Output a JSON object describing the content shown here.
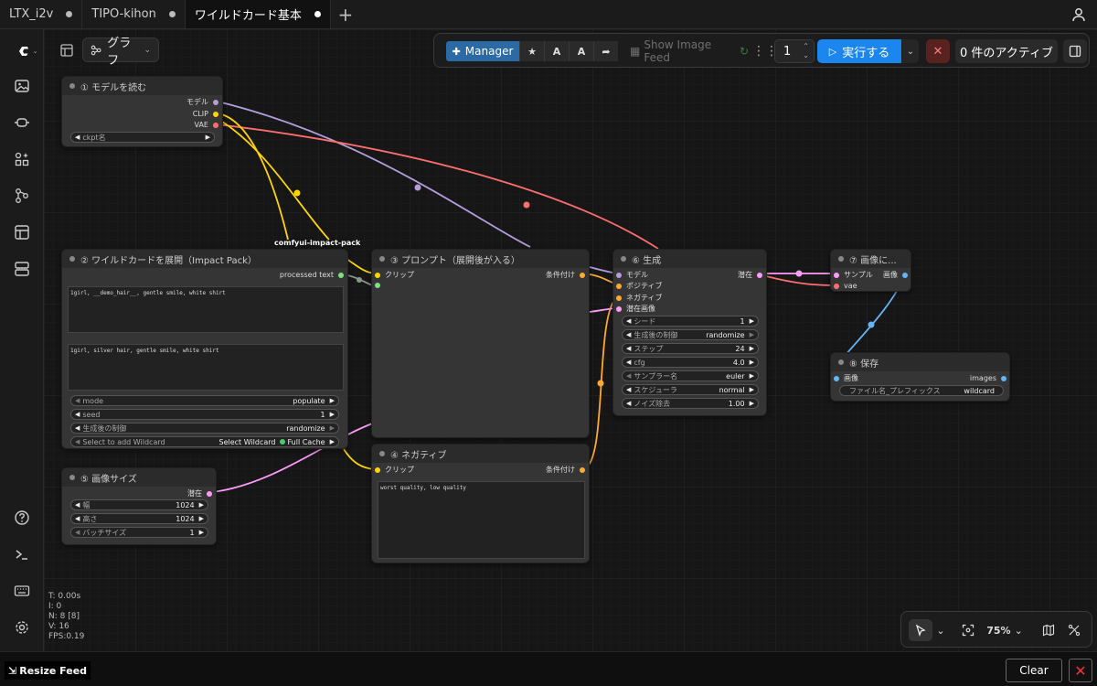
{
  "tabs": [
    {
      "label": "LTX_i2v"
    },
    {
      "label": "TIPO-kihon"
    },
    {
      "label": "ワイルドカード基本"
    }
  ],
  "toolbar": {
    "graph_label": "グラフ",
    "manager_label": "Manager",
    "show_feed_label": "Show Image Feed",
    "batch_count": "1",
    "run_label": "実行する",
    "queue_label": "0 件のアクティブ"
  },
  "group_label": "comfyui-impact-pack",
  "nodes": {
    "n1": {
      "title": "① モデルを読む",
      "outputs": [
        "モデル",
        "CLIP",
        "VAE"
      ],
      "widget_label": "ckpt名"
    },
    "n2": {
      "title": "② ワイルドカードを展開（Impact Pack）",
      "output": "processed text",
      "text1": "1girl, __demo_hair__, gentle smile, white shirt",
      "text2": "1girl, silver hair, gentle smile, white shirt",
      "widgets": [
        {
          "label": "mode",
          "value": "populate"
        },
        {
          "label": "seed",
          "value": "1"
        },
        {
          "label": "生成後の制御",
          "value": "randomize"
        }
      ],
      "wildcard": {
        "label": "Select to add Wildcard",
        "value": "Select Wildcard",
        "cache": "Full Cache"
      }
    },
    "n3": {
      "title": "③ プロンプト（展開後が入る）",
      "input": "クリップ",
      "output": "条件付け"
    },
    "n4": {
      "title": "④ ネガティブ",
      "input": "クリップ",
      "output": "条件付け",
      "text": "worst quality, low quality"
    },
    "n5": {
      "title": "⑤ 画像サイズ",
      "output": "潜在",
      "widgets": [
        {
          "label": "幅",
          "value": "1024"
        },
        {
          "label": "高さ",
          "value": "1024"
        },
        {
          "label": "バッチサイズ",
          "value": "1"
        }
      ]
    },
    "n6": {
      "title": "⑥ 生成",
      "inputs": [
        "モデル",
        "ポジティブ",
        "ネガティブ",
        "潜在画像"
      ],
      "output": "潜在",
      "widgets": [
        {
          "label": "シード",
          "value": "1"
        },
        {
          "label": "生成後の制御",
          "value": "randomize"
        },
        {
          "label": "ステップ",
          "value": "24"
        },
        {
          "label": "cfg",
          "value": "4.0"
        },
        {
          "label": "サンプラー名",
          "value": "euler"
        },
        {
          "label": "スケジューラ",
          "value": "normal"
        },
        {
          "label": "ノイズ除去",
          "value": "1.00"
        }
      ]
    },
    "n7": {
      "title": "⑦ 画像に...",
      "inputs": [
        "サンプル",
        "vae"
      ],
      "output": "画像"
    },
    "n8": {
      "title": "⑧ 保存",
      "input": "画像",
      "output": "images",
      "widget_label": "ファイル名_プレフィックス",
      "widget_value": "wildcard"
    }
  },
  "stats": [
    "T: 0.00s",
    "I: 0",
    "N: 8 [8]",
    "V: 16",
    "FPS:0.19"
  ],
  "canvas_tools": {
    "zoom": "75%"
  },
  "bottom": {
    "resize_label": "Resize Feed",
    "clear_label": "Clear"
  },
  "colors": {
    "model": "#b39ddb",
    "clip": "#ffd500",
    "vae": "#ff6e6e",
    "conditioning": "#ffa931",
    "latent": "#ff9cf9",
    "image": "#64b5f6",
    "string": "#7ee07e",
    "accent": "#1b86f0"
  }
}
